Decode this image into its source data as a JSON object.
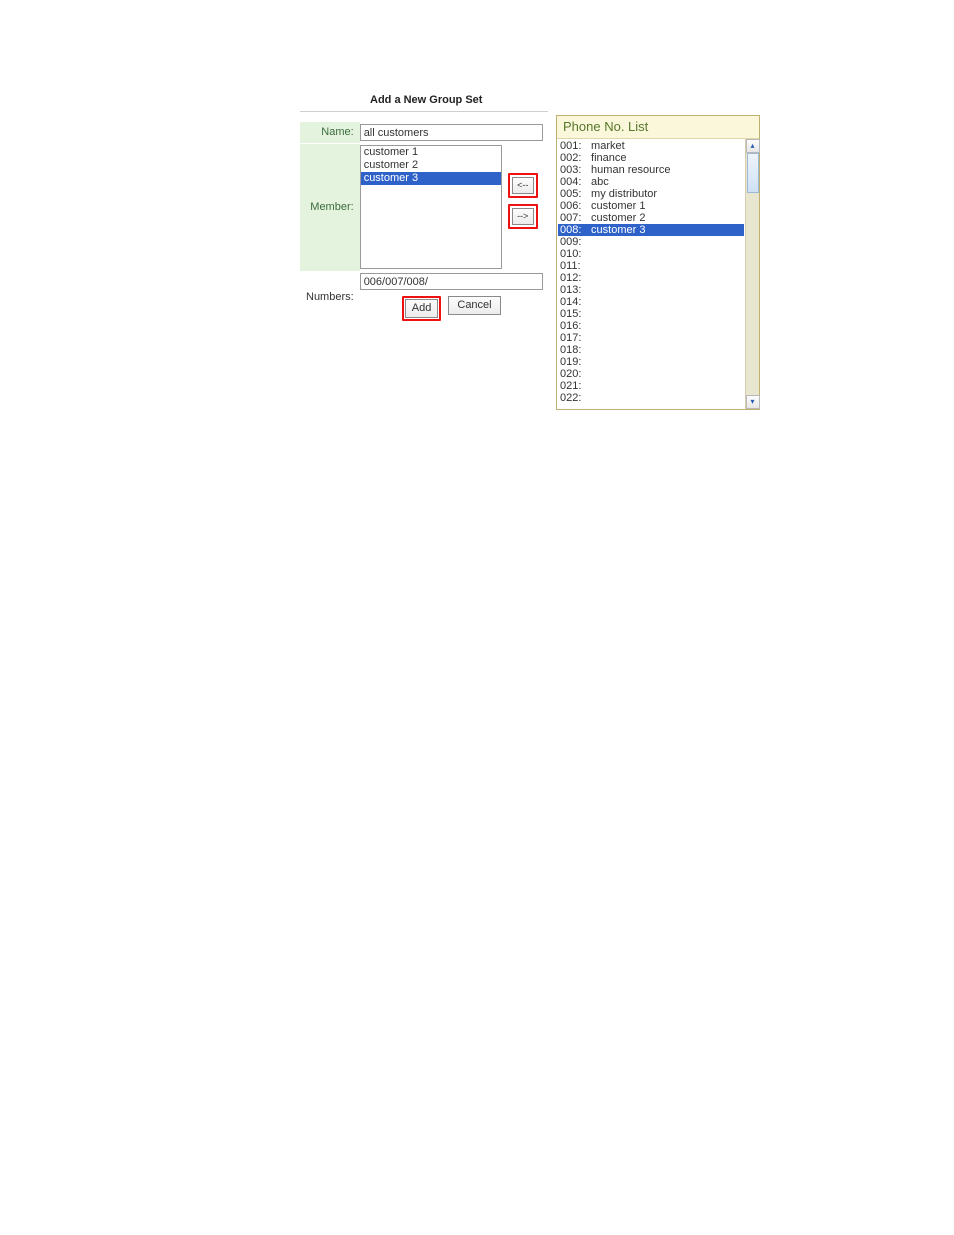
{
  "title": "Add a New Group Set",
  "labels": {
    "name": "Name:",
    "member": "Member:",
    "numbers": "Numbers:"
  },
  "fields": {
    "name": "all customers",
    "numbers": "006/007/008/"
  },
  "member_items": [
    {
      "text": "customer 1",
      "selected": false
    },
    {
      "text": "customer 2",
      "selected": false
    },
    {
      "text": "customer 3",
      "selected": true
    }
  ],
  "move_buttons": {
    "left": "<--",
    "right": "-->"
  },
  "action_buttons": {
    "add": "Add",
    "cancel": "Cancel"
  },
  "phone_panel_title": "Phone No. List",
  "phone_list": [
    {
      "num": "001:",
      "label": "market",
      "selected": false
    },
    {
      "num": "002:",
      "label": "finance",
      "selected": false
    },
    {
      "num": "003:",
      "label": "human resource",
      "selected": false
    },
    {
      "num": "004:",
      "label": "abc",
      "selected": false
    },
    {
      "num": "005:",
      "label": "my distributor",
      "selected": false
    },
    {
      "num": "006:",
      "label": "customer 1",
      "selected": false
    },
    {
      "num": "007:",
      "label": "customer 2",
      "selected": false
    },
    {
      "num": "008:",
      "label": "customer 3",
      "selected": true
    },
    {
      "num": "009:",
      "label": "",
      "selected": false
    },
    {
      "num": "010:",
      "label": "",
      "selected": false
    },
    {
      "num": "011:",
      "label": "",
      "selected": false
    },
    {
      "num": "012:",
      "label": "",
      "selected": false
    },
    {
      "num": "013:",
      "label": "",
      "selected": false
    },
    {
      "num": "014:",
      "label": "",
      "selected": false
    },
    {
      "num": "015:",
      "label": "",
      "selected": false
    },
    {
      "num": "016:",
      "label": "",
      "selected": false
    },
    {
      "num": "017:",
      "label": "",
      "selected": false
    },
    {
      "num": "018:",
      "label": "",
      "selected": false
    },
    {
      "num": "019:",
      "label": "",
      "selected": false
    },
    {
      "num": "020:",
      "label": "",
      "selected": false
    },
    {
      "num": "021:",
      "label": "",
      "selected": false
    },
    {
      "num": "022:",
      "label": "",
      "selected": false
    }
  ]
}
